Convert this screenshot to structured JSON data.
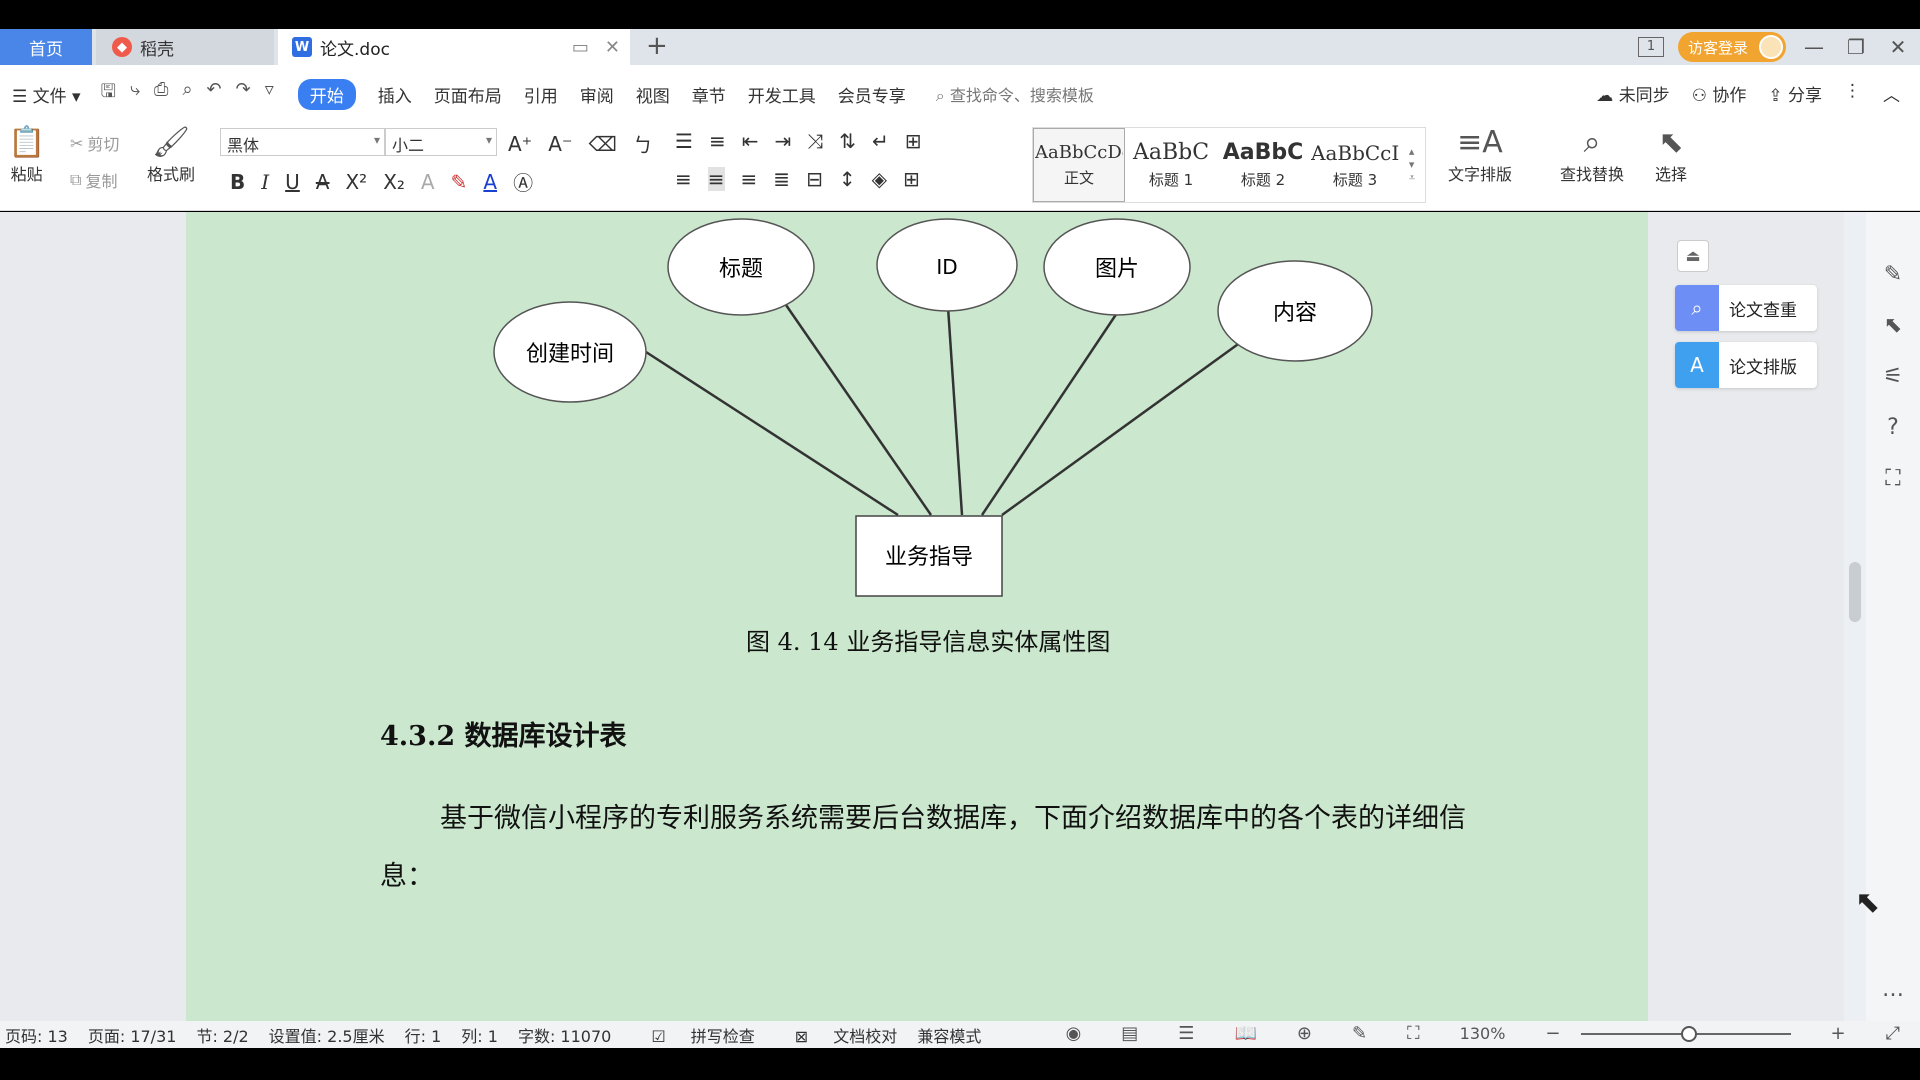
{
  "tabs": {
    "home": "首页",
    "draft": "稻壳",
    "doc": "论文.doc",
    "new_tab": "+"
  },
  "titlebar": {
    "page_indicator": "1",
    "login": "访客登录",
    "minimize": "—",
    "restore": "❐",
    "close": "✕"
  },
  "menubar": {
    "file": "文件",
    "items": [
      "开始",
      "插入",
      "页面布局",
      "引用",
      "审阅",
      "视图",
      "章节",
      "开发工具",
      "会员专享"
    ],
    "search_placeholder": "查找命令、搜索模板",
    "sync": "未同步",
    "collab": "协作",
    "share": "分享"
  },
  "ribbon": {
    "paste": "粘贴",
    "cut": "剪切",
    "copy": "复制",
    "format_painter": "格式刷",
    "font_name": "黑体",
    "font_size": "小二",
    "styles": [
      {
        "preview": "AaBbCcDd",
        "name": "正文"
      },
      {
        "preview": "AaBbC",
        "name": "标题 1"
      },
      {
        "preview": "AaBbC",
        "name": "标题 2"
      },
      {
        "preview": "AaBbCcI",
        "name": "标题 3"
      }
    ],
    "text_layout": "文字排版",
    "find_replace": "查找替换",
    "select": "选择"
  },
  "diagram": {
    "entity": "业务指导",
    "attributes": [
      "创建时间",
      "标题",
      "ID",
      "图片",
      "内容"
    ]
  },
  "document": {
    "caption": "图 4. 14  业务指导信息实体属性图",
    "heading": "4.3.2 数据库设计表",
    "paragraph": "基于微信小程序的专利服务系统需要后台数据库，下面介绍数据库中的各个表的详细信息："
  },
  "side_panel": {
    "check": "论文查重",
    "format": "论文排版"
  },
  "statusbar": {
    "page_code": "页码: 13",
    "page": "页面: 17/31",
    "section": "节: 2/2",
    "setting": "设置值: 2.5厘米",
    "row": "行: 1",
    "col": "列: 1",
    "words": "字数: 11070",
    "spell": "拼写检查",
    "proof": "文档校对",
    "compat": "兼容模式",
    "zoom": "130%"
  }
}
